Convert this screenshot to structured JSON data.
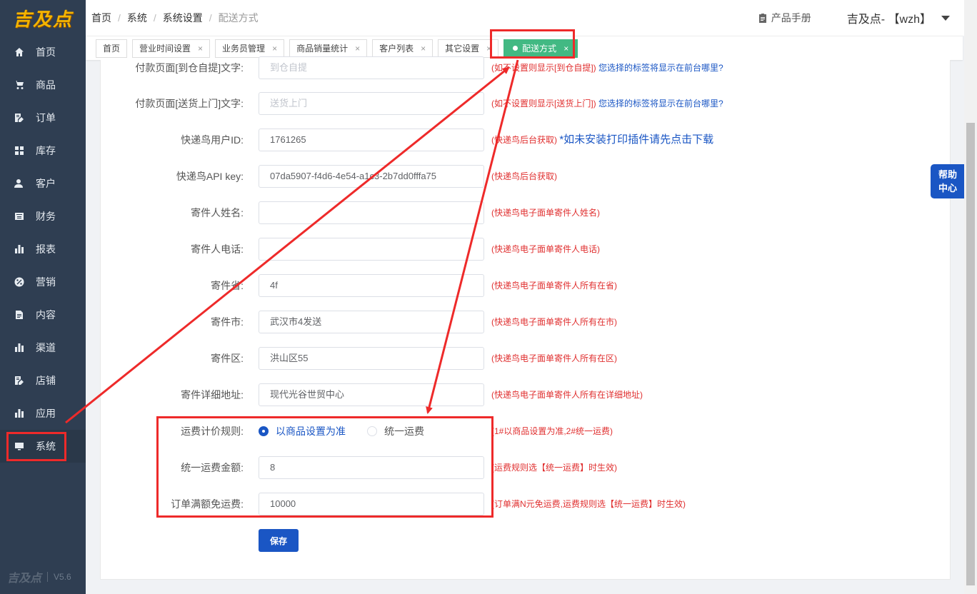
{
  "sidebar": {
    "logo": "吉及点",
    "items": [
      {
        "label": "首页"
      },
      {
        "label": "商品"
      },
      {
        "label": "订单"
      },
      {
        "label": "库存"
      },
      {
        "label": "客户"
      },
      {
        "label": "财务"
      },
      {
        "label": "报表"
      },
      {
        "label": "营销"
      },
      {
        "label": "内容"
      },
      {
        "label": "渠道"
      },
      {
        "label": "店铺"
      },
      {
        "label": "应用"
      },
      {
        "label": "系统"
      }
    ],
    "footer_logo": "吉及点",
    "version": "V5.6"
  },
  "header": {
    "breadcrumb": [
      "首页",
      "系统",
      "系统设置",
      "配送方式"
    ],
    "manual": "产品手册",
    "user": "吉及点- 【wzh】"
  },
  "tabs": [
    {
      "label": "首页"
    },
    {
      "label": "营业时间设置"
    },
    {
      "label": "业务员管理"
    },
    {
      "label": "商品销量统计"
    },
    {
      "label": "客户列表"
    },
    {
      "label": "其它设置"
    },
    {
      "label": "配送方式"
    }
  ],
  "form": {
    "pickup_text": {
      "label": "付款页面[到仓自提]文字:",
      "placeholder": "到仓自提",
      "hint": "(如不设置则显示[到仓自提])",
      "hint_blue": "您选择的标签将显示在前台哪里?"
    },
    "delivery_text": {
      "label": "付款页面[送货上门]文字:",
      "placeholder": "送货上门",
      "hint": "(如不设置则显示[送货上门])",
      "hint_blue": "您选择的标签将显示在前台哪里?"
    },
    "kdn_user_id": {
      "label": "快递鸟用户ID:",
      "value": "1761265",
      "hint": "(快递鸟后台获取)",
      "hint_blue": "*如未安装打印插件请先点击下载"
    },
    "kdn_api_key": {
      "label": "快递鸟API key:",
      "value": "07da5907-f4d6-4e54-a1c3-2b7dd0fffa75",
      "hint": "(快递鸟后台获取)"
    },
    "sender_name": {
      "label": "寄件人姓名:",
      "value": "",
      "hint": "(快递鸟电子面单寄件人姓名)"
    },
    "sender_phone": {
      "label": "寄件人电话:",
      "value": "",
      "hint": "(快递鸟电子面单寄件人电话)"
    },
    "sender_province": {
      "label": "寄件省:",
      "value": "4f",
      "hint": "(快递鸟电子面单寄件人所有在省)"
    },
    "sender_city": {
      "label": "寄件市:",
      "value": "武汉市4发送",
      "hint": "(快递鸟电子面单寄件人所有在市)"
    },
    "sender_district": {
      "label": "寄件区:",
      "value": "洪山区55",
      "hint": "(快递鸟电子面单寄件人所有在区)"
    },
    "sender_address": {
      "label": "寄件详细地址:",
      "value": "现代光谷世贸中心",
      "hint": "(快递鸟电子面单寄件人所有在详细地址)"
    },
    "fee_rule": {
      "label": "运费计价规则:",
      "option1": "以商品设置为准",
      "option2": "统一运费",
      "selected": "以商品设置为准",
      "hint": "(1#以商品设置为准,2#统一运费)"
    },
    "flat_fee": {
      "label": "统一运费金额:",
      "value": "8",
      "hint": "(运费规则选【统一运费】时生效)"
    },
    "free_threshold": {
      "label": "订单满额免运费:",
      "value": "10000",
      "hint": "(订单满N元免运费,运费规则选【统一运费】时生效)"
    },
    "save_label": "保存"
  },
  "help": {
    "line1": "帮助",
    "line2": "中心"
  },
  "colors": {
    "sidebar": "#2f3e52",
    "primary": "#1a56c4",
    "active_tab": "#42b983",
    "hint": "#e03030",
    "annotation": "#ee2a2a"
  }
}
